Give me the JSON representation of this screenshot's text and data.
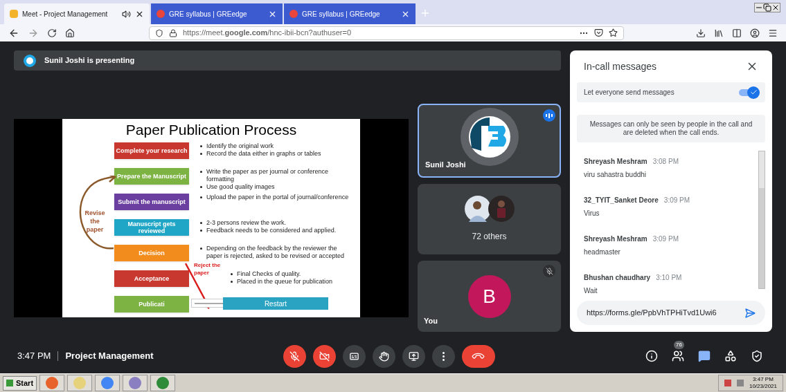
{
  "browser": {
    "tabs": [
      {
        "title": "Meet - Project Management",
        "selected": true,
        "audio": true
      },
      {
        "title": "GRE syllabus | GREedge",
        "selected": false,
        "audio": false
      },
      {
        "title": "GRE syllabus | GREedge",
        "selected": false,
        "audio": false
      }
    ],
    "url": "https://meet.**google.com**/hnc-ibii-bcn?authuser=0"
  },
  "presenting_banner": "Sunil Joshi is presenting",
  "slide": {
    "title": "Paper Publication Process",
    "steps": [
      {
        "label": "Complete your research",
        "color": "#c8382e",
        "bullets": [
          "Identify the original work",
          "Record the data either in graphs or tables"
        ]
      },
      {
        "label": "Prepare the Manuscript",
        "color": "#7cb342",
        "bullets": [
          "Write the paper as per journal or conference formatting",
          "Use good quality images"
        ]
      },
      {
        "label": "Submit the manuscript",
        "color": "#6b3fa0",
        "bullets": [
          "Upload the paper in the portal of journal/conference"
        ]
      },
      {
        "label": "Manuscript gets reviewed",
        "color": "#1fa5c6",
        "bullets": [
          "2-3 persons review the work.",
          "Feedback needs to be considered and applied."
        ]
      },
      {
        "label": "Decision",
        "color": "#f28c1c",
        "bullets": [
          "Depending on the feedback by the reviewer the paper is rejected, asked to be revised or accepted"
        ]
      },
      {
        "label": "Acceptance",
        "color": "#c8382e",
        "bullets": [
          "Final Checks of quality.",
          "Placed in the queue for publication"
        ]
      },
      {
        "label": "Publicati",
        "color": "#7cb342"
      }
    ],
    "revise_label": "Revise the paper",
    "reject_label": "Reject the paper",
    "restart": "Restart"
  },
  "tiles": [
    {
      "kind": "logo",
      "name": "Sunil Joshi",
      "speaking": true,
      "muted": false
    },
    {
      "kind": "group",
      "name": "72 others",
      "speaking": false,
      "muted": false
    },
    {
      "kind": "initial",
      "name": "You",
      "initial": "B",
      "speaking": false,
      "muted": true
    }
  ],
  "chat": {
    "title": "In-call messages",
    "setting": {
      "label": "Let everyone send messages",
      "on": true
    },
    "notice": "Messages can only be seen by people in the call and are deleted when the call ends.",
    "messages": [
      {
        "sender": "Shreyash Meshram",
        "time": "3:08 PM",
        "text": "viru sahastra buddhi"
      },
      {
        "sender": "32_TYIT_Sanket Deore",
        "time": "3:09 PM",
        "text": "Virus"
      },
      {
        "sender": "Shreyash Meshram",
        "time": "3:09 PM",
        "text": "headmaster"
      },
      {
        "sender": "Bhushan chaudhary",
        "time": "3:10 PM",
        "text": "Wait"
      }
    ],
    "input": "https://forms.gle/PpbVhTPHiTvd1Uwi6"
  },
  "bottom": {
    "time": "3:47 PM",
    "meeting": "Project Management",
    "controls": [
      {
        "kind": "mic",
        "off": true
      },
      {
        "kind": "camera",
        "off": true
      },
      {
        "kind": "captions",
        "off": false
      },
      {
        "kind": "hand",
        "off": false
      },
      {
        "kind": "present",
        "off": false
      },
      {
        "kind": "more",
        "off": false
      },
      {
        "kind": "leave",
        "off": true
      }
    ],
    "people_count": "76",
    "side": [
      {
        "kind": "info",
        "selected": false
      },
      {
        "kind": "people",
        "selected": false
      },
      {
        "kind": "chat",
        "selected": true
      },
      {
        "kind": "activities",
        "selected": false
      },
      {
        "kind": "safety",
        "selected": false
      }
    ]
  },
  "taskbar": {
    "start": "Start",
    "time": "3:47 PM",
    "date": "10/23/2021"
  }
}
